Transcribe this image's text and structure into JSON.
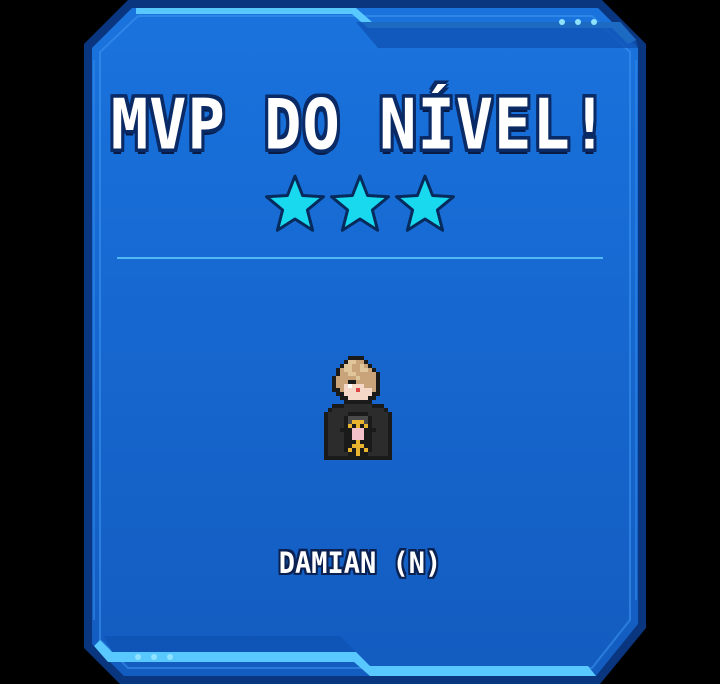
{
  "card": {
    "title": "MVP DO NÍVEL!",
    "star_count": 3,
    "player_name": "DAMIAN (N)"
  },
  "colors": {
    "panel_fill": "#1a6fd6",
    "panel_border": "#0d3f93",
    "accent_cyan": "#4fd8ff",
    "star": "#19d9ee",
    "star_outline": "#062a5c"
  },
  "icons": {
    "star": "star-icon",
    "dots": "dots-icon",
    "character": "player-sprite"
  }
}
